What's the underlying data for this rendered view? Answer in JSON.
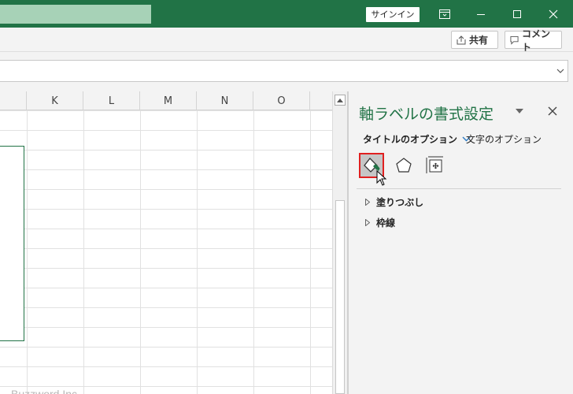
{
  "titlebar": {
    "signin_label": "サインイン",
    "bg_color": "#217346"
  },
  "ribbon": {
    "share_label": "共有",
    "comment_label": "コメント"
  },
  "grid": {
    "columns": [
      "K",
      "L",
      "M",
      "N",
      "O"
    ],
    "watermark": "Buzzword Inc."
  },
  "format_pane": {
    "title": "軸ラベルの書式設定",
    "tab_title_options": "タイトルのオプション",
    "tab_text_options": "文字のオプション",
    "icons": [
      "fill-line-icon",
      "effects-icon",
      "size-properties-icon"
    ],
    "selected_icon": "fill-line-icon",
    "sections": [
      {
        "label": "塗りつぶし",
        "expanded": false
      },
      {
        "label": "枠線",
        "expanded": false
      }
    ],
    "accent_color": "#217346",
    "highlight_color": "#e02020"
  }
}
